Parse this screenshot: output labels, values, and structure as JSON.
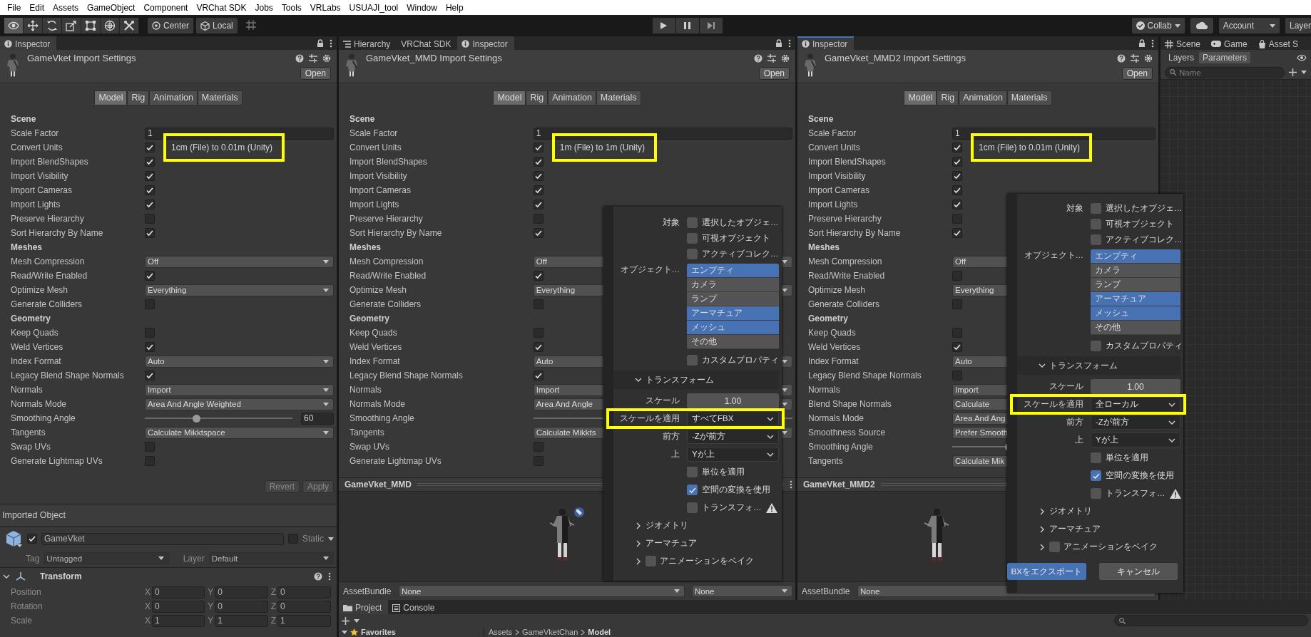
{
  "menu": [
    "File",
    "Edit",
    "Assets",
    "GameObject",
    "Component",
    "VRChat SDK",
    "Jobs",
    "Tools",
    "VRLabs",
    "USUAJI_tool",
    "Window",
    "Help"
  ],
  "toolbar": {
    "tools": [
      {
        "kind": "view",
        "selected": true
      },
      {
        "kind": "move",
        "selected": false
      },
      {
        "kind": "rotate",
        "selected": false
      },
      {
        "kind": "scale",
        "selected": false
      },
      {
        "kind": "rect",
        "selected": false
      },
      {
        "kind": "transform",
        "selected": false
      },
      {
        "kind": "custom",
        "selected": false
      }
    ],
    "pivot": "Center",
    "space": "Local",
    "collab": "Collab",
    "account": "Account",
    "layers": "Layer"
  },
  "inspectors": [
    {
      "tabs": [
        {
          "label": "Inspector",
          "kind": "inspector",
          "selected": true,
          "focused": false
        }
      ],
      "title": "GameVket Import Settings",
      "open": "Open",
      "model_tabs": [
        {
          "label": "Model",
          "selected": true
        },
        {
          "label": "Rig",
          "selected": false
        },
        {
          "label": "Animation",
          "selected": false
        },
        {
          "label": "Materials",
          "selected": false
        }
      ],
      "rows": [
        {
          "kind": "header",
          "label": "Scene"
        },
        {
          "kind": "field",
          "label": "Scale Factor",
          "value": "1"
        },
        {
          "kind": "check",
          "label": "Convert Units",
          "checked": true,
          "note": "1cm (File) to 0.01m (Unity)",
          "highlighted": true
        },
        {
          "kind": "check",
          "label": "Import BlendShapes",
          "checked": true
        },
        {
          "kind": "check",
          "label": "Import Visibility",
          "checked": true
        },
        {
          "kind": "check",
          "label": "Import Cameras",
          "checked": true
        },
        {
          "kind": "check",
          "label": "Import Lights",
          "checked": true
        },
        {
          "kind": "check",
          "label": "Preserve Hierarchy",
          "checked": false
        },
        {
          "kind": "check",
          "label": "Sort Hierarchy By Name",
          "checked": true
        },
        {
          "kind": "header",
          "label": "Meshes"
        },
        {
          "kind": "dropdown",
          "label": "Mesh Compression",
          "value": "Off"
        },
        {
          "kind": "check",
          "label": "Read/Write Enabled",
          "checked": true
        },
        {
          "kind": "dropdown",
          "label": "Optimize Mesh",
          "value": "Everything"
        },
        {
          "kind": "check",
          "label": "Generate Colliders",
          "checked": false
        },
        {
          "kind": "header",
          "label": "Geometry"
        },
        {
          "kind": "check",
          "label": "Keep Quads",
          "checked": false
        },
        {
          "kind": "check",
          "label": "Weld Vertices",
          "checked": true
        },
        {
          "kind": "dropdown",
          "label": "Index Format",
          "value": "Auto"
        },
        {
          "kind": "check",
          "label": "Legacy Blend Shape Normals",
          "checked": true
        },
        {
          "kind": "dropdown",
          "label": "Normals",
          "value": "Import"
        },
        {
          "kind": "dropdown",
          "label": "Normals Mode",
          "value": "Area And Angle Weighted"
        },
        {
          "kind": "slider",
          "label": "Smoothing Angle",
          "level": 0.34,
          "value": "60"
        },
        {
          "kind": "dropdown",
          "label": "Tangents",
          "value": "Calculate Mikktspace"
        },
        {
          "kind": "check",
          "label": "Swap UVs",
          "checked": false
        },
        {
          "kind": "check",
          "label": "Generate Lightmap UVs",
          "checked": false
        }
      ],
      "footer_buttons": [
        {
          "label": "Revert",
          "disabled": true
        },
        {
          "label": "Apply",
          "disabled": true
        }
      ],
      "imported_object": {
        "title": "Imported Object",
        "name": "GameVket",
        "active": true,
        "static_label": "Static",
        "static": false,
        "tag_label": "Tag",
        "tag": "Untagged",
        "layer_label": "Layer",
        "layer": "Default"
      },
      "transform": {
        "title": "Transform",
        "expanded": true,
        "rows": [
          {
            "label": "Position",
            "values": [
              {
                "axis": "X",
                "value": "0"
              },
              {
                "axis": "Y",
                "value": "0"
              },
              {
                "axis": "Z",
                "value": "0"
              }
            ]
          },
          {
            "label": "Rotation",
            "values": [
              {
                "axis": "X",
                "value": "0"
              },
              {
                "axis": "Y",
                "value": "0"
              },
              {
                "axis": "Z",
                "value": "0"
              }
            ]
          },
          {
            "label": "Scale",
            "values": [
              {
                "axis": "X",
                "value": "1"
              },
              {
                "axis": "Y",
                "value": "1"
              },
              {
                "axis": "Z",
                "value": "1"
              }
            ]
          }
        ]
      }
    },
    {
      "tabs": [
        {
          "label": "Hierarchy",
          "kind": "hierarchy",
          "selected": false,
          "focused": false
        },
        {
          "label": "VRChat SDK",
          "kind": "plain",
          "selected": false,
          "focused": false
        },
        {
          "label": "Inspector",
          "kind": "inspector",
          "selected": true,
          "focused": false
        }
      ],
      "title": "GameVket_MMD Import Settings",
      "open": "Open",
      "model_tabs": [
        {
          "label": "Model",
          "selected": true
        },
        {
          "label": "Rig",
          "selected": false
        },
        {
          "label": "Animation",
          "selected": false
        },
        {
          "label": "Materials",
          "selected": false
        }
      ],
      "rows": [
        {
          "kind": "header",
          "label": "Scene"
        },
        {
          "kind": "field",
          "label": "Scale Factor",
          "value": "1"
        },
        {
          "kind": "check",
          "label": "Convert Units",
          "checked": true,
          "note": "1m (File) to 1m (Unity)",
          "highlighted": true
        },
        {
          "kind": "check",
          "label": "Import BlendShapes",
          "checked": true
        },
        {
          "kind": "check",
          "label": "Import Visibility",
          "checked": true
        },
        {
          "kind": "check",
          "label": "Import Cameras",
          "checked": true
        },
        {
          "kind": "check",
          "label": "Import Lights",
          "checked": true
        },
        {
          "kind": "check",
          "label": "Preserve Hierarchy",
          "checked": false
        },
        {
          "kind": "check",
          "label": "Sort Hierarchy By Name",
          "checked": true
        },
        {
          "kind": "header",
          "label": "Meshes"
        },
        {
          "kind": "dropdown",
          "label": "Mesh Compression",
          "value": "Off"
        },
        {
          "kind": "check",
          "label": "Read/Write Enabled",
          "checked": true
        },
        {
          "kind": "dropdown",
          "label": "Optimize Mesh",
          "value": "Everything"
        },
        {
          "kind": "check",
          "label": "Generate Colliders",
          "checked": false
        },
        {
          "kind": "header",
          "label": "Geometry"
        },
        {
          "kind": "check",
          "label": "Keep Quads",
          "checked": false
        },
        {
          "kind": "check",
          "label": "Weld Vertices",
          "checked": true
        },
        {
          "kind": "dropdown",
          "label": "Index Format",
          "value": "Auto"
        },
        {
          "kind": "check",
          "label": "Legacy Blend Shape Normals",
          "checked": true
        },
        {
          "kind": "dropdown",
          "label": "Normals",
          "value": "Import"
        },
        {
          "kind": "dropdown",
          "label": "Normals Mode",
          "value": "Area And Angle"
        },
        {
          "kind": "slider",
          "label": "Smoothing Angle"
        },
        {
          "kind": "dropdown",
          "label": "Tangents",
          "value": "Calculate Mikkts"
        },
        {
          "kind": "check",
          "label": "Swap UVs",
          "checked": false
        },
        {
          "kind": "check",
          "label": "Generate Lightmap UVs",
          "checked": false
        }
      ],
      "preview": {
        "title": "GameVket_MMD"
      },
      "asset_bundle": {
        "label": "AssetBundle",
        "values": [
          "None",
          "None"
        ]
      }
    },
    {
      "tabs": [
        {
          "label": "Inspector",
          "kind": "inspector",
          "selected": true,
          "focused": true
        }
      ],
      "title": "GameVket_MMD2 Import Settings",
      "open": "Open",
      "model_tabs": [
        {
          "label": "Model",
          "selected": true
        },
        {
          "label": "Rig",
          "selected": false
        },
        {
          "label": "Animation",
          "selected": false
        },
        {
          "label": "Materials",
          "selected": false
        }
      ],
      "rows": [
        {
          "kind": "header",
          "label": "Scene"
        },
        {
          "kind": "field",
          "label": "Scale Factor",
          "value": "1"
        },
        {
          "kind": "check",
          "label": "Convert Units",
          "checked": true,
          "note": "1cm (File) to 0.01m (Unity)",
          "highlighted": true
        },
        {
          "kind": "check",
          "label": "Import BlendShapes",
          "checked": true
        },
        {
          "kind": "check",
          "label": "Import Visibility",
          "checked": true
        },
        {
          "kind": "check",
          "label": "Import Cameras",
          "checked": true
        },
        {
          "kind": "check",
          "label": "Import Lights",
          "checked": true
        },
        {
          "kind": "check",
          "label": "Preserve Hierarchy",
          "checked": false
        },
        {
          "kind": "check",
          "label": "Sort Hierarchy By Name",
          "checked": true
        },
        {
          "kind": "header",
          "label": "Meshes"
        },
        {
          "kind": "dropdown",
          "label": "Mesh Compression",
          "value": "Off"
        },
        {
          "kind": "check",
          "label": "Read/Write Enabled",
          "checked": false
        },
        {
          "kind": "dropdown",
          "label": "Optimize Mesh",
          "value": "Everything"
        },
        {
          "kind": "check",
          "label": "Generate Colliders",
          "checked": false
        },
        {
          "kind": "header",
          "label": "Geometry"
        },
        {
          "kind": "check",
          "label": "Keep Quads",
          "checked": false
        },
        {
          "kind": "check",
          "label": "Weld Vertices",
          "checked": true
        },
        {
          "kind": "dropdown",
          "label": "Index Format",
          "value": "Auto"
        },
        {
          "kind": "check",
          "label": "Legacy Blend Shape Normals",
          "checked": false
        },
        {
          "kind": "dropdown",
          "label": "Normals",
          "value": "Import"
        },
        {
          "kind": "dropdown",
          "label": "Blend Shape Normals",
          "value": "Calculate"
        },
        {
          "kind": "dropdown",
          "label": "Normals Mode",
          "value": "Area And Ang"
        },
        {
          "kind": "dropdown",
          "label": "Smoothness Source",
          "value": "Prefer Smooth"
        },
        {
          "kind": "slider",
          "label": "Smoothing Angle",
          "level": 0.27
        },
        {
          "kind": "dropdown",
          "label": "Tangents",
          "value": "Calculate Mik"
        }
      ],
      "preview": {
        "title": "GameVket_MMD2"
      },
      "asset_bundle": {
        "label": "AssetBundle",
        "values": [
          "None"
        ]
      }
    }
  ],
  "export_dialogs": [
    {
      "rows": [
        {
          "kind": "check",
          "label": "対象",
          "text": "選択したオブジェ…",
          "checked": false
        },
        {
          "kind": "check",
          "text": "可視オブジェクト",
          "checked": false
        },
        {
          "kind": "check",
          "text": "アクティブコレク…",
          "checked": false
        },
        {
          "kind": "list",
          "label": "オブジェクト…",
          "items": [
            {
              "text": "エンプティ",
              "selected": true
            },
            {
              "text": "カメラ",
              "selected": false
            },
            {
              "text": "ランプ",
              "selected": false
            },
            {
              "text": "アーマチュア",
              "selected": true
            },
            {
              "text": "メッシュ",
              "selected": true
            },
            {
              "text": "その他",
              "selected": false
            }
          ]
        },
        {
          "kind": "check",
          "text": "カスタムプロパティ",
          "checked": false
        },
        {
          "kind": "section",
          "text": "トランスフォーム",
          "expanded": true
        },
        {
          "kind": "number",
          "label": "スケール",
          "value": "1.00"
        },
        {
          "kind": "select",
          "label": "スケールを適用",
          "value": "すべてFBX",
          "highlighted": true
        },
        {
          "kind": "select",
          "label": "前方",
          "value": "-Zが前方"
        },
        {
          "kind": "select",
          "label": "上",
          "value": "Yが上"
        },
        {
          "kind": "check",
          "text": "単位を適用",
          "checked": false
        },
        {
          "kind": "check",
          "text": "空間の変換を使用",
          "checked": true
        },
        {
          "kind": "check",
          "text": "トランスフォ…",
          "checked": false,
          "warning": true
        },
        {
          "kind": "section",
          "text": "ジオメトリ",
          "expanded": false
        },
        {
          "kind": "section",
          "text": "アーマチュア",
          "expanded": false
        },
        {
          "kind": "check-section",
          "text": "アニメーションをベイク",
          "expanded": false,
          "checked": false
        }
      ]
    },
    {
      "rows": [
        {
          "kind": "check",
          "label": "対象",
          "text": "選択したオブジェ…",
          "checked": false
        },
        {
          "kind": "check",
          "text": "可視オブジェクト",
          "checked": false
        },
        {
          "kind": "check",
          "text": "アクティブコレク…",
          "checked": false
        },
        {
          "kind": "list",
          "label": "オブジェクト…",
          "items": [
            {
              "text": "エンプティ",
              "selected": true
            },
            {
              "text": "カメラ",
              "selected": false
            },
            {
              "text": "ランプ",
              "selected": false
            },
            {
              "text": "アーマチュア",
              "selected": true
            },
            {
              "text": "メッシュ",
              "selected": true
            },
            {
              "text": "その他",
              "selected": false
            }
          ]
        },
        {
          "kind": "check",
          "text": "カスタムプロパティ",
          "checked": false
        },
        {
          "kind": "section",
          "text": "トランスフォーム",
          "expanded": true
        },
        {
          "kind": "number",
          "label": "スケール",
          "value": "1.00"
        },
        {
          "kind": "select",
          "label": "スケールを適用",
          "value": "全ローカル",
          "highlighted": true
        },
        {
          "kind": "select",
          "label": "前方",
          "value": "-Zが前方"
        },
        {
          "kind": "select",
          "label": "上",
          "value": "Yが上"
        },
        {
          "kind": "check",
          "text": "単位を適用",
          "checked": false
        },
        {
          "kind": "check",
          "text": "空間の変換を使用",
          "checked": true
        },
        {
          "kind": "check",
          "text": "トランスフォ…",
          "checked": false,
          "warning": true
        },
        {
          "kind": "section",
          "text": "ジオメトリ",
          "expanded": false
        },
        {
          "kind": "section",
          "text": "アーマチュア",
          "expanded": false
        },
        {
          "kind": "check-section",
          "text": "アニメーションをベイク",
          "expanded": false,
          "checked": false
        }
      ],
      "buttons": [
        {
          "text": "BXをエクスポート",
          "kind": "primary"
        },
        {
          "text": "キャンセル",
          "kind": "secondary"
        }
      ]
    }
  ],
  "side_panel": {
    "tabs": [
      {
        "label": "Scene",
        "kind": "scene",
        "selected": false
      },
      {
        "label": "Game",
        "kind": "game",
        "selected": false
      },
      {
        "label": "Asset S",
        "kind": "asset",
        "selected": false
      }
    ],
    "subtabs": [
      {
        "label": "Layers",
        "selected": false
      },
      {
        "label": "Parameters",
        "selected": true
      }
    ],
    "search_placeholder": "Name"
  },
  "project": {
    "tabs": [
      {
        "label": "Project",
        "kind": "project",
        "selected": true
      },
      {
        "label": "Console",
        "kind": "console",
        "selected": false
      }
    ],
    "favorites": "Favorites",
    "breadcrumb": [
      "Assets",
      "GameVketChan",
      "Model"
    ]
  }
}
